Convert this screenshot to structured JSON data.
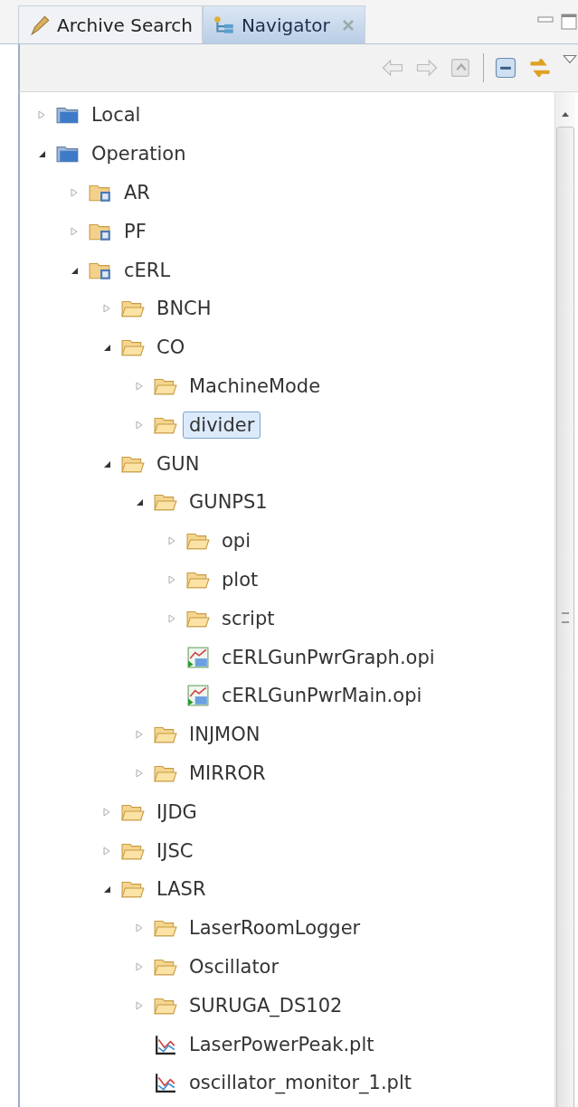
{
  "tabs": [
    {
      "label": "Archive Search",
      "kind": "search",
      "selected": false
    },
    {
      "label": "Navigator",
      "kind": "navigator",
      "selected": true
    }
  ],
  "tree": [
    {
      "label": "Local",
      "kind": "root",
      "expanded": false,
      "selected": false
    },
    {
      "label": "Operation",
      "kind": "root",
      "expanded": true,
      "selected": false,
      "children": [
        {
          "label": "AR",
          "kind": "project",
          "expanded": false,
          "selected": false
        },
        {
          "label": "PF",
          "kind": "project",
          "expanded": false,
          "selected": false
        },
        {
          "label": "cERL",
          "kind": "project",
          "expanded": true,
          "selected": false,
          "children": [
            {
              "label": "BNCH",
              "kind": "folder",
              "expanded": false,
              "selected": false
            },
            {
              "label": "CO",
              "kind": "folder",
              "expanded": true,
              "selected": false,
              "children": [
                {
                  "label": "MachineMode",
                  "kind": "folder",
                  "expanded": false,
                  "selected": false
                },
                {
                  "label": "divider",
                  "kind": "folder",
                  "expanded": false,
                  "selected": true
                }
              ]
            },
            {
              "label": "GUN",
              "kind": "folder",
              "expanded": true,
              "selected": false,
              "children": [
                {
                  "label": "GUNPS1",
                  "kind": "folder",
                  "expanded": true,
                  "selected": false,
                  "children": [
                    {
                      "label": "opi",
                      "kind": "folder",
                      "expanded": false,
                      "selected": false
                    },
                    {
                      "label": "plot",
                      "kind": "folder",
                      "expanded": false,
                      "selected": false
                    },
                    {
                      "label": "script",
                      "kind": "folder",
                      "expanded": false,
                      "selected": false
                    },
                    {
                      "label": "cERLGunPwrGraph.opi",
                      "kind": "opi",
                      "selected": false
                    },
                    {
                      "label": "cERLGunPwrMain.opi",
                      "kind": "opi",
                      "selected": false
                    }
                  ]
                },
                {
                  "label": "INJMON",
                  "kind": "folder",
                  "expanded": false,
                  "selected": false
                },
                {
                  "label": "MIRROR",
                  "kind": "folder",
                  "expanded": false,
                  "selected": false
                }
              ]
            },
            {
              "label": "IJDG",
              "kind": "folder",
              "expanded": false,
              "selected": false
            },
            {
              "label": "IJSC",
              "kind": "folder",
              "expanded": false,
              "selected": false
            },
            {
              "label": "LASR",
              "kind": "folder",
              "expanded": true,
              "selected": false,
              "children": [
                {
                  "label": "LaserRoomLogger",
                  "kind": "folder",
                  "expanded": false,
                  "selected": false
                },
                {
                  "label": "Oscillator",
                  "kind": "folder",
                  "expanded": false,
                  "selected": false
                },
                {
                  "label": "SURUGA_DS102",
                  "kind": "folder",
                  "expanded": false,
                  "selected": false
                },
                {
                  "label": "LaserPowerPeak.plt",
                  "kind": "plt",
                  "selected": false
                },
                {
                  "label": "oscillator_monitor_1.plt",
                  "kind": "plt",
                  "selected": false
                }
              ]
            }
          ]
        }
      ]
    }
  ]
}
